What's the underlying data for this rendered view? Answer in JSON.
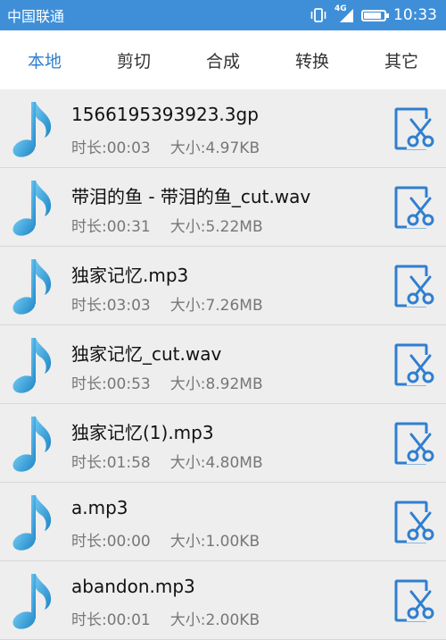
{
  "status_bar": {
    "carrier": "中国联通",
    "network_type": "4G",
    "time": "10:33",
    "battery_level": 0.85
  },
  "tabs": [
    {
      "label": "本地",
      "active": true
    },
    {
      "label": "剪切",
      "active": false
    },
    {
      "label": "合成",
      "active": false
    },
    {
      "label": "转换",
      "active": false
    },
    {
      "label": "其它",
      "active": false
    }
  ],
  "files": [
    {
      "name": "1566195393923.3gp",
      "duration": "时长:00:03",
      "size": "大小:4.97KB"
    },
    {
      "name": "带泪的鱼 - 带泪的鱼_cut.wav",
      "duration": "时长:00:31",
      "size": "大小:5.22MB"
    },
    {
      "name": "独家记忆.mp3",
      "duration": "时长:03:03",
      "size": "大小:7.26MB"
    },
    {
      "name": "独家记忆_cut.wav",
      "duration": "时长:00:53",
      "size": "大小:8.92MB"
    },
    {
      "name": "独家记忆(1).mp3",
      "duration": "时长:01:58",
      "size": "大小:4.80MB"
    },
    {
      "name": "a.mp3",
      "duration": "时长:00:00",
      "size": "大小:1.00KB"
    },
    {
      "name": "abandon.mp3",
      "duration": "时长:00:01",
      "size": "大小:2.00KB"
    }
  ],
  "icons": {
    "file_icon": "music-note-icon",
    "action_icon": "cut-icon"
  },
  "colors": {
    "accent": "#2f7fd0",
    "status_bar": "#3f8fd8",
    "note": "#2a9bd6"
  }
}
